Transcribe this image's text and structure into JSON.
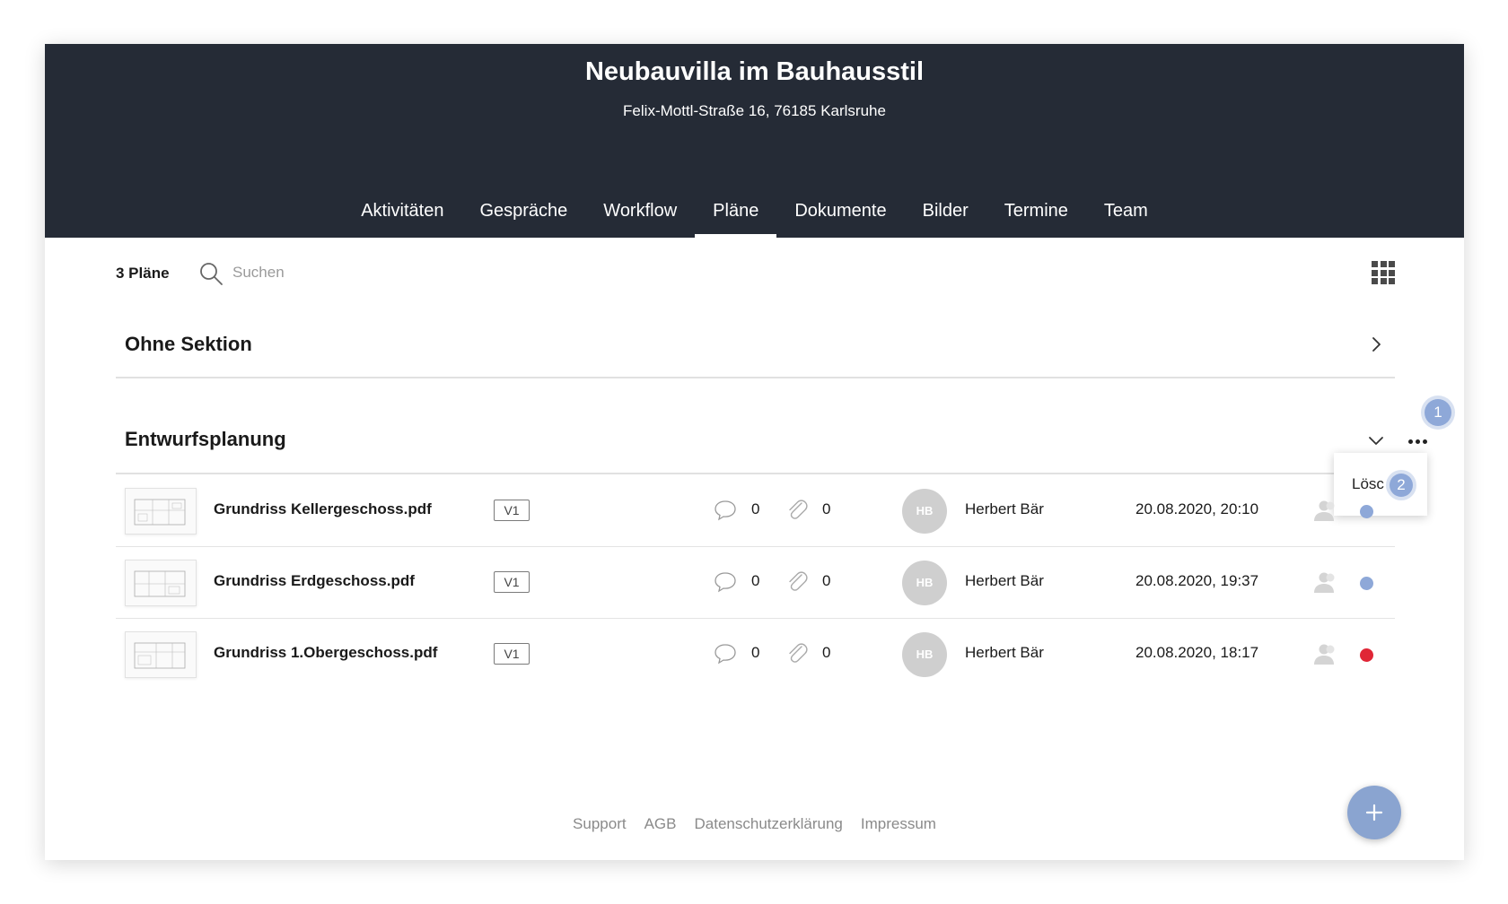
{
  "project": {
    "title": "Neubauvilla im Bauhausstil",
    "address": "Felix-Mottl-Straße 16, 76185 Karlsruhe"
  },
  "nav": {
    "tabs": [
      {
        "label": "Aktivitäten"
      },
      {
        "label": "Gespräche"
      },
      {
        "label": "Workflow"
      },
      {
        "label": "Pläne"
      },
      {
        "label": "Dokumente"
      },
      {
        "label": "Bilder"
      },
      {
        "label": "Termine"
      },
      {
        "label": "Team"
      }
    ],
    "active": "Pläne"
  },
  "toolbar": {
    "count": "3 Pläne",
    "search_placeholder": "Suchen"
  },
  "sections": [
    {
      "title": "Ohne Sektion",
      "state": "collapsed"
    },
    {
      "title": "Entwurfsplanung",
      "state": "expanded"
    }
  ],
  "annotations": {
    "badge1": "1",
    "badge2": "2"
  },
  "popup": {
    "label": "Lösc"
  },
  "files": [
    {
      "name": "Grundriss Kellergeschoss.pdf",
      "version": "V1",
      "comments": "0",
      "attachments": "0",
      "initials": "HB",
      "user": "Herbert Bär",
      "date": "20.08.2020, 20:10",
      "status_color": "#8ea8d8"
    },
    {
      "name": "Grundriss Erdgeschoss.pdf",
      "version": "V1",
      "comments": "0",
      "attachments": "0",
      "initials": "HB",
      "user": "Herbert Bär",
      "date": "20.08.2020, 19:37",
      "status_color": "#8ea8d8"
    },
    {
      "name": "Grundriss 1.Obergeschoss.pdf",
      "version": "V1",
      "comments": "0",
      "attachments": "0",
      "initials": "HB",
      "user": "Herbert Bär",
      "date": "20.08.2020, 18:17",
      "status_color": "#e02636"
    }
  ],
  "footer": {
    "links": [
      {
        "label": "Support"
      },
      {
        "label": "AGB"
      },
      {
        "label": "Datenschutzerklärung"
      },
      {
        "label": "Impressum"
      }
    ]
  },
  "colors": {
    "header_bg": "#252b36",
    "accent": "#8aa4d0",
    "status_blue": "#8ea8d8",
    "status_red": "#e02636"
  }
}
